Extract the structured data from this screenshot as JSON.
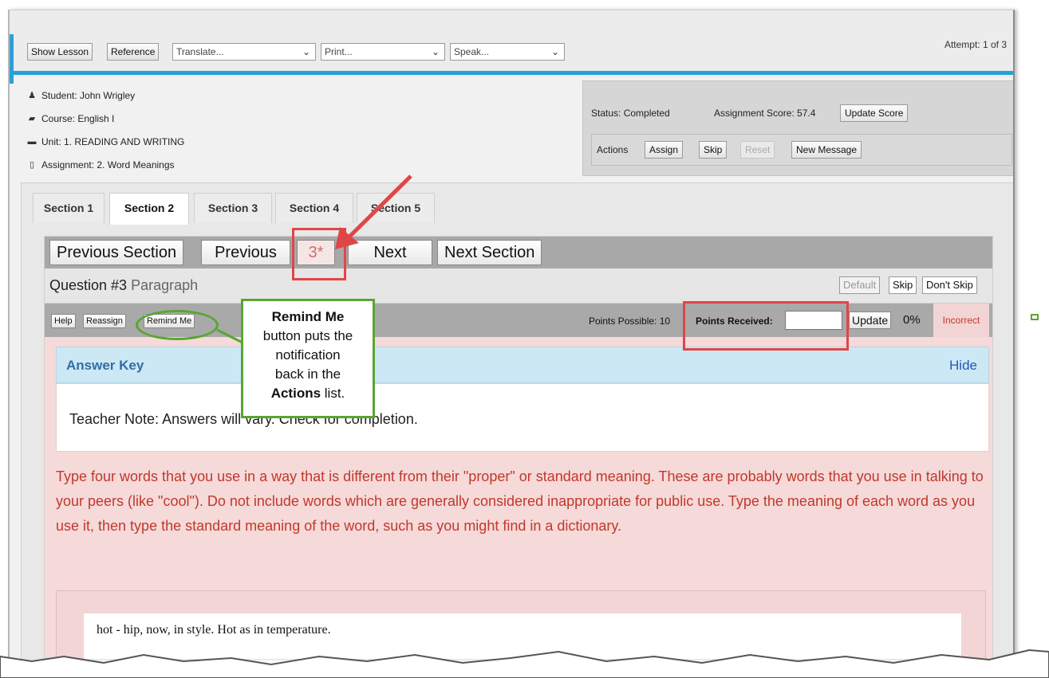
{
  "toolbar": {
    "show_lesson": "Show Lesson",
    "reference": "Reference",
    "translate": "Translate...",
    "print": "Print...",
    "speak": "Speak...",
    "attempt": "Attempt: 1 of 3"
  },
  "info": {
    "student": "Student: John Wrigley",
    "course": "Course: English I",
    "unit": "Unit: 1. READING AND WRITING",
    "assignment": "Assignment: 2. Word Meanings"
  },
  "status": {
    "status": "Status: Completed",
    "score": "Assignment Score: 57.4",
    "update_score": "Update Score",
    "actions_label": "Actions",
    "assign": "Assign",
    "skip": "Skip",
    "reset": "Reset",
    "new_message": "New Message"
  },
  "tabs": [
    "Section 1",
    "Section 2",
    "Section 3",
    "Section 4",
    "Section 5"
  ],
  "nav": {
    "previous_section": "Previous Section",
    "previous": "Previous",
    "current": "3*",
    "next": "Next",
    "next_section": "Next Section"
  },
  "question": {
    "number": "Question #3",
    "type": "Paragraph",
    "default": "Default",
    "skip": "Skip",
    "dont_skip": "Don't Skip"
  },
  "subbar": {
    "help": "Help",
    "reassign": "Reassign",
    "remind_me": "Remind Me",
    "points_possible": "Points Possible: 10",
    "points_received": "Points Received:",
    "update": "Update",
    "percent": "0%",
    "incorrect": "Incorrect"
  },
  "answer_key": {
    "title": "Answer Key",
    "hide": "Hide",
    "teacher_note": "Teacher Note: Answers will vary. Check for completion."
  },
  "prompt": "Type four words that you use in a way that is different from their \"proper\" or standard meaning. These are probably words that you use in talking to your peers (like \"cool\"). Do not include words which are generally considered inappropriate for public use. Type the meaning of each word as you use it, then type the standard meaning of the word, such as you might find in a dictionary.",
  "student_answer": "hot - hip, now, in style. Hot as in temperature.",
  "callout": {
    "title": "Remind Me",
    "line1": "button puts the",
    "line2": "notification",
    "line3": "back in the",
    "bold": "Actions",
    "tail": " list."
  },
  "colors": {
    "accent_blue": "#22a2d8",
    "annotation_red": "#e04646",
    "annotation_green": "#5aa531",
    "prompt_red": "#c0392b"
  }
}
